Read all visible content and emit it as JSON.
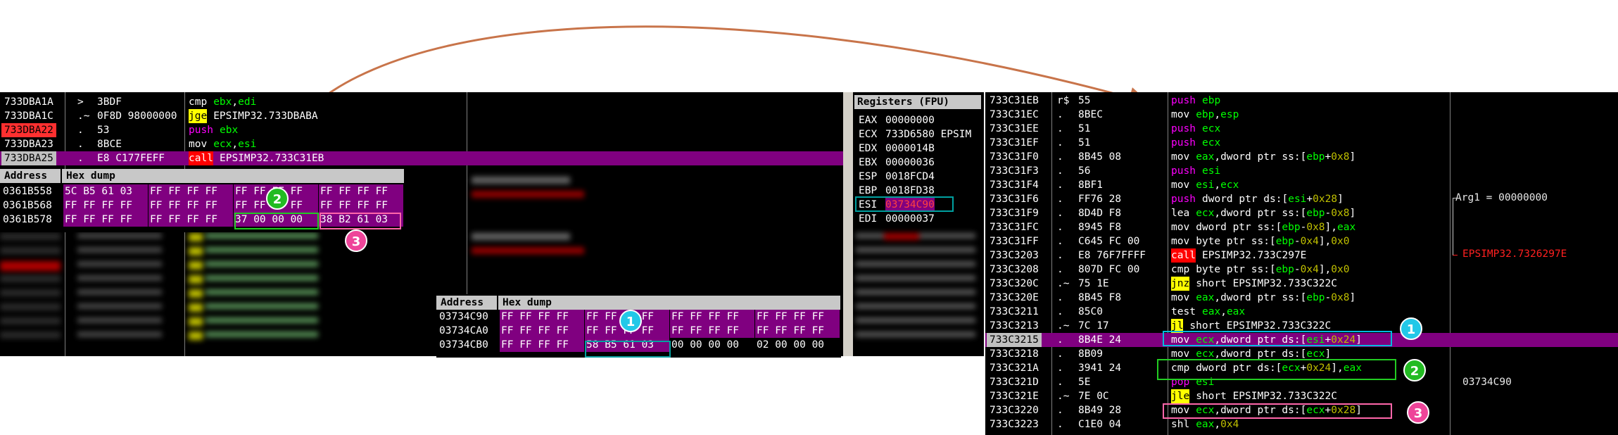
{
  "colors": {
    "purple": "#800080",
    "yellow": "#ffff00",
    "red": "#ff0000",
    "green": "#00ff00",
    "cyan": "#00ffff",
    "magenta": "#ff00ff",
    "teal": "#00a0a0",
    "badge1": "#22c8e8",
    "badge2": "#22bb22",
    "badge3": "#ee4499"
  },
  "disasm_left": {
    "rows": [
      {
        "addr": "733DBA1A",
        "mark": ">",
        "bytes": "3BDF",
        "mn": "cmp",
        "ops": "ebx,edi"
      },
      {
        "addr": "733DBA1C",
        "mark": ".~",
        "bytes": "0F8D 98000000",
        "mn": "jge",
        "ops": "EPSIMP32.733DBABA"
      },
      {
        "addr": "733DBA22",
        "mark": ".",
        "bytes": "53",
        "mn": "push",
        "ops": "ebx"
      },
      {
        "addr": "733DBA23",
        "mark": ".",
        "bytes": "8BCE",
        "mn": "mov",
        "ops": "ecx,esi"
      },
      {
        "addr": "733DBA25",
        "mark": ".",
        "bytes": "E8 C177FEFF",
        "mn": "call",
        "ops": "EPSIMP32.733C31EB"
      }
    ]
  },
  "dump1": {
    "header_address": "Address",
    "header_hex": "Hex dump",
    "rows": [
      {
        "addr": "0361B558",
        "groups": [
          "5C B5 61 03",
          "FF FF FF FF",
          "FF FF FF FF",
          "FF FF FF FF"
        ]
      },
      {
        "addr": "0361B568",
        "groups": [
          "FF FF FF FF",
          "FF FF FF FF",
          "FF FF FF FF",
          "FF FF FF FF"
        ]
      },
      {
        "addr": "0361B578",
        "groups": [
          "FF FF FF FF",
          "FF FF FF FF",
          "37 00 00 00",
          "38 B2 61 03"
        ]
      }
    ]
  },
  "registers": {
    "title": "Registers (FPU)",
    "rows": [
      {
        "name": "EAX",
        "value": "00000000"
      },
      {
        "name": "ECX",
        "value": "733D6580 EPSIM"
      },
      {
        "name": "EDX",
        "value": "0000014B"
      },
      {
        "name": "EBX",
        "value": "00000036"
      },
      {
        "name": "ESP",
        "value": "0018FCD4"
      },
      {
        "name": "EBP",
        "value": "0018FD38"
      },
      {
        "name": "ESI",
        "value": "03734C90"
      },
      {
        "name": "EDI",
        "value": "00000037"
      }
    ]
  },
  "dump2": {
    "header_address": "Address",
    "header_hex": "Hex dump",
    "rows": [
      {
        "addr": "03734C90",
        "groups": [
          "FF FF FF FF",
          "FF FF FF FF",
          "FF FF FF FF",
          "FF FF FF FF"
        ]
      },
      {
        "addr": "03734CA0",
        "groups": [
          "FF FF FF FF",
          "FF FF FF FF",
          "FF FF FF FF",
          "FF FF FF FF"
        ]
      },
      {
        "addr": "03734CB0",
        "groups": [
          "FF FF FF FF",
          "58 B5 61 03",
          "00 00 00 00",
          "02 00 00 00"
        ]
      }
    ]
  },
  "disasm_right": {
    "rows": [
      {
        "addr": "733C31EB",
        "mark": "r$",
        "bytes": "55",
        "mn": "push",
        "ops": "ebp"
      },
      {
        "addr": "733C31EC",
        "mark": ".",
        "bytes": "8BEC",
        "mn": "mov",
        "ops": "ebp,esp"
      },
      {
        "addr": "733C31EE",
        "mark": ".",
        "bytes": "51",
        "mn": "push",
        "ops": "ecx"
      },
      {
        "addr": "733C31EF",
        "mark": ".",
        "bytes": "51",
        "mn": "push",
        "ops": "ecx"
      },
      {
        "addr": "733C31F0",
        "mark": ".",
        "bytes": "8B45 08",
        "mn": "mov",
        "ops": "eax,dword ptr ss:[ebp+0x8]"
      },
      {
        "addr": "733C31F3",
        "mark": ".",
        "bytes": "56",
        "mn": "push",
        "ops": "esi"
      },
      {
        "addr": "733C31F4",
        "mark": ".",
        "bytes": "8BF1",
        "mn": "mov",
        "ops": "esi,ecx"
      },
      {
        "addr": "733C31F6",
        "mark": ".",
        "bytes": "FF76 28",
        "mn": "push",
        "ops": "dword ptr ds:[esi+0x28]"
      },
      {
        "addr": "733C31F9",
        "mark": ".",
        "bytes": "8D4D F8",
        "mn": "lea",
        "ops": "ecx,dword ptr ss:[ebp-0x8]"
      },
      {
        "addr": "733C31FC",
        "mark": ".",
        "bytes": "8945 F8",
        "mn": "mov",
        "ops": "dword ptr ss:[ebp-0x8],eax"
      },
      {
        "addr": "733C31FF",
        "mark": ".",
        "bytes": "C645 FC 00",
        "mn": "mov",
        "ops": "byte ptr ss:[ebp-0x4],0x0"
      },
      {
        "addr": "733C3203",
        "mark": ".",
        "bytes": "E8 76F7FFFF",
        "mn": "call",
        "ops": "EPSIMP32.733C297E"
      },
      {
        "addr": "733C3208",
        "mark": ".",
        "bytes": "807D FC 00",
        "mn": "cmp",
        "ops": "byte ptr ss:[ebp-0x4],0x0"
      },
      {
        "addr": "733C320C",
        "mark": ".~",
        "bytes": "75 1E",
        "mn": "jnz",
        "ops": "short EPSIMP32.733C322C"
      },
      {
        "addr": "733C320E",
        "mark": ".",
        "bytes": "8B45 F8",
        "mn": "mov",
        "ops": "eax,dword ptr ss:[ebp-0x8]"
      },
      {
        "addr": "733C3211",
        "mark": ".",
        "bytes": "85C0",
        "mn": "test",
        "ops": "eax,eax"
      },
      {
        "addr": "733C3213",
        "mark": ".~",
        "bytes": "7C 17",
        "mn": "jl",
        "ops": "short EPSIMP32.733C322C"
      },
      {
        "addr": "733C3215",
        "mark": ".",
        "bytes": "8B4E 24",
        "mn": "mov",
        "ops": "ecx,dword ptr ds:[esi+0x24]"
      },
      {
        "addr": "733C3218",
        "mark": ".",
        "bytes": "8B09",
        "mn": "mov",
        "ops": "ecx,dword ptr ds:[ecx]"
      },
      {
        "addr": "733C321A",
        "mark": ".",
        "bytes": "3941 24",
        "mn": "cmp",
        "ops": "dword ptr ds:[ecx+0x24],eax"
      },
      {
        "addr": "733C321D",
        "mark": ".",
        "bytes": "5E",
        "mn": "pop",
        "ops": "esi"
      },
      {
        "addr": "733C321E",
        "mark": ".~",
        "bytes": "7E 0C",
        "mn": "jle",
        "ops": "short EPSIMP32.733C322C"
      },
      {
        "addr": "733C3220",
        "mark": ".",
        "bytes": "8B49 28",
        "mn": "mov",
        "ops": "ecx,dword ptr ds:[ecx+0x28]"
      },
      {
        "addr": "733C3223",
        "mark": ".",
        "bytes": "C1E0 04",
        "mn": "shl",
        "ops": "eax,0x4"
      }
    ],
    "comments": {
      "arg1": "Arg1 = 00000000",
      "callee": "EPSIMP32.7326297E",
      "esi_value": "03734C90"
    }
  },
  "badges": {
    "one": "1",
    "two": "2",
    "three": "3"
  }
}
